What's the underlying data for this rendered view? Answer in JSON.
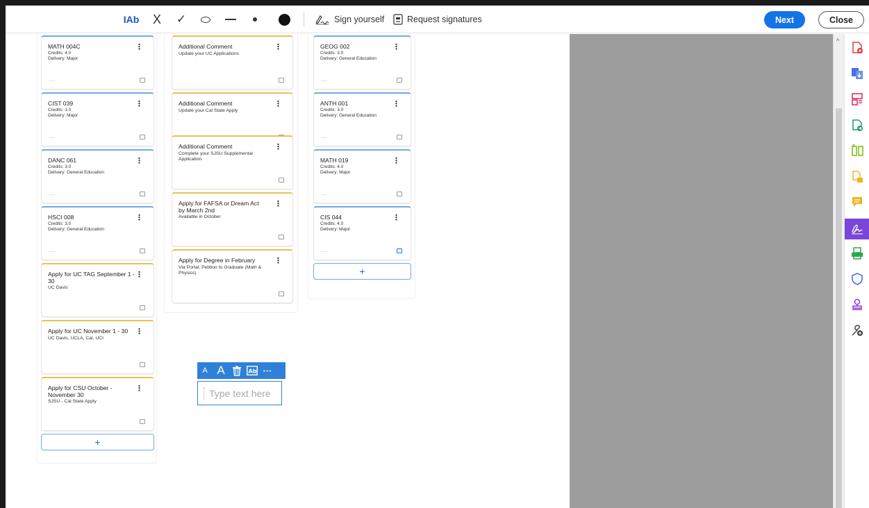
{
  "toolbar": {
    "text_tool_label": "IAb",
    "cross_label": "X",
    "check_label": "✓",
    "sign_yourself": "Sign yourself",
    "request_signatures": "Request signatures",
    "next": "Next",
    "close": "Close"
  },
  "columns": [
    {
      "cards": [
        {
          "title": "MATH 004C",
          "credits": "Credits: 4.0",
          "delivery": "Delivery: Major",
          "kind": "course"
        },
        {
          "title": "CIST 039",
          "credits": "Credits: 3.0",
          "delivery": "Delivery: Major",
          "kind": "course"
        },
        {
          "title": "DANC 061",
          "credits": "Credits: 3.0",
          "delivery": "Delivery: General Education",
          "kind": "course"
        },
        {
          "title": "HSCI 008",
          "credits": "Credits: 3.0",
          "delivery": "Delivery: General Education",
          "kind": "course"
        },
        {
          "title": "Apply for UC TAG September 1 - 30",
          "sub": "UC Davis",
          "kind": "task"
        },
        {
          "title": "Apply for UC November 1 - 30",
          "sub": "UC Davis, UCLA, Cal, UCI",
          "kind": "task"
        },
        {
          "title": "Apply for CSU October - November 30",
          "sub": "SJSU - Cal State Apply",
          "kind": "task"
        }
      ]
    },
    {
      "cards": [
        {
          "title": "Additional Comment",
          "sub": "Update your UC Applications",
          "kind": "task"
        },
        {
          "title": "Additional Comment",
          "sub": "Update your Cal State Apply",
          "kind": "task"
        },
        {
          "title": "Additional Comment",
          "sub": "Complete your SJSU Supplemental Application",
          "kind": "task"
        },
        {
          "title": "Apply for FAFSA or Dream Act by March 2nd",
          "sub": "Available in October",
          "kind": "task"
        },
        {
          "title": "Apply for Degree in February",
          "sub": "Via Portal, Petition to Graduate (Math & Physics)",
          "kind": "task"
        }
      ]
    },
    {
      "cards": [
        {
          "title": "GEOG 002",
          "credits": "Credits: 3.0",
          "delivery": "Delivery: General Education",
          "kind": "course"
        },
        {
          "title": "ANTH 001",
          "credits": "Credits: 3.0",
          "delivery": "Delivery: General Education",
          "kind": "course"
        },
        {
          "title": "MATH 019",
          "credits": "Credits: 4.0",
          "delivery": "Delivery: Major",
          "kind": "course"
        },
        {
          "title": "CIS 044",
          "credits": "Credits: 4.0",
          "delivery": "Delivery: Major",
          "kind": "course",
          "note_active": true
        }
      ]
    }
  ],
  "common": {
    "kebab": "⋮",
    "dots": "...",
    "add": "+"
  },
  "text_tool": {
    "placeholder": "Type text here",
    "small_a": "A",
    "large_a": "A",
    "more": "···"
  },
  "colors": {
    "accent": "#1473e6",
    "course_border": "#6fa8e8",
    "task_border": "#e9c24b",
    "rail_active": "#7a45d9"
  }
}
